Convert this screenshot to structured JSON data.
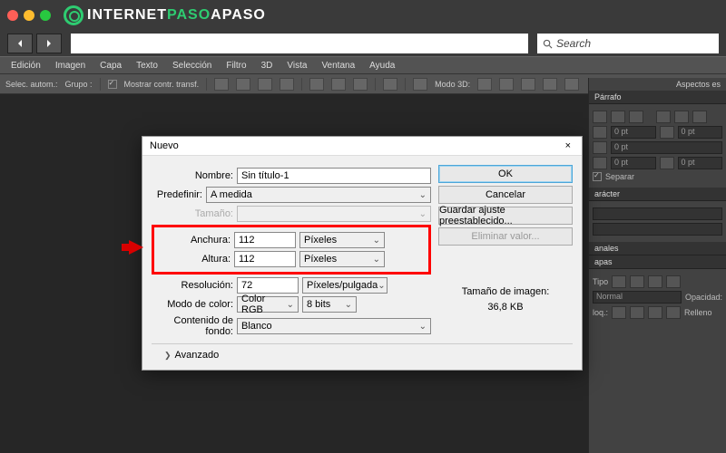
{
  "window": {
    "brand_a": "INTERNET",
    "brand_b": "PASO",
    "brand_c": "APASO"
  },
  "search": {
    "placeholder": "Search"
  },
  "menu": [
    "Edición",
    "Imagen",
    "Capa",
    "Texto",
    "Selección",
    "Filtro",
    "3D",
    "Vista",
    "Ventana",
    "Ayuda"
  ],
  "toolbar": {
    "sel": "Selec. autom.:",
    "group": "Grupo :",
    "show_controls": "Mostrar contr. transf.",
    "mode3d": "Modo 3D:"
  },
  "panels": {
    "aspects": "Aspectos es",
    "paragraph": "Párrafo",
    "character": "arácter",
    "channels": "anales",
    "layers": "apas",
    "type": "Tipo",
    "normal": "Normal",
    "opacity": "Opacidad:",
    "lock": "loq.:",
    "fill": "Relleno",
    "separate": "Separar",
    "pt0": "0 pt"
  },
  "dialog": {
    "title": "Nuevo",
    "name_label": "Nombre:",
    "name_value": "Sin título-1",
    "preset_label": "Predefinir:",
    "preset_value": "A medida",
    "size_label": "Tamaño:",
    "width_label": "Anchura:",
    "width_value": "112",
    "height_label": "Altura:",
    "height_value": "112",
    "pixels": "Píxeles",
    "res_label": "Resolución:",
    "res_value": "72",
    "res_unit": "Píxeles/pulgada",
    "color_label": "Modo de color:",
    "color_value": "Color RGB",
    "bits": "8 bits",
    "bg_label": "Contenido de fondo:",
    "bg_value": "Blanco",
    "advanced": "Avanzado",
    "ok": "OK",
    "cancel": "Cancelar",
    "save_preset": "Guardar ajuste preestablecido...",
    "delete_value": "Eliminar valor...",
    "size_info_label": "Tamaño de imagen:",
    "size_info_value": "36,8 KB"
  }
}
